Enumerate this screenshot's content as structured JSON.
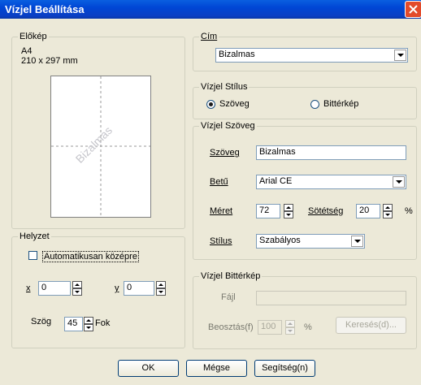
{
  "window": {
    "title": "Vízjel Beállítása"
  },
  "preview": {
    "group_label": "Előkép",
    "paper_size": "A4",
    "paper_dims": "210 x 297 mm",
    "watermark_text": "Bizalmas"
  },
  "position": {
    "group_label": "Helyzet",
    "auto_center_label": "Automatikusan középre",
    "auto_center_checked": false,
    "x_label": "x",
    "x_value": "0",
    "y_label": "y",
    "y_value": "0",
    "angle_label": "Szög",
    "angle_value": "45",
    "angle_unit": "Fok"
  },
  "title_group": {
    "label": "Cím",
    "selected": "Bizalmas"
  },
  "style_group": {
    "label": "Vízjel Stílus",
    "option_text": "Szöveg",
    "option_bitmap": "Bittérkép",
    "selected": "Szöveg"
  },
  "text_group": {
    "label": "Vízjel Szöveg",
    "text_label": "Szöveg",
    "text_value": "Bizalmas",
    "font_label": "Betű",
    "font_value": "Arial CE",
    "size_label": "Méret",
    "size_value": "72",
    "darkness_label": "Sötétség",
    "darkness_value": "20",
    "percent": "%",
    "style_label": "Stílus",
    "style_value": "Szabályos"
  },
  "bitmap_group": {
    "label": "Vízjel Bittérkép",
    "file_label": "Fájl",
    "file_value": "",
    "scale_label": "Beosztás(f)",
    "scale_value": "100",
    "percent": "%",
    "browse_label": "Keresés(d)..."
  },
  "buttons": {
    "ok": "OK",
    "cancel": "Mégse",
    "help": "Segítség(n)"
  },
  "colors": {
    "titlebar": "#0046d5",
    "dialog": "#ECE9D8",
    "watermark": "#c6c6cc"
  }
}
